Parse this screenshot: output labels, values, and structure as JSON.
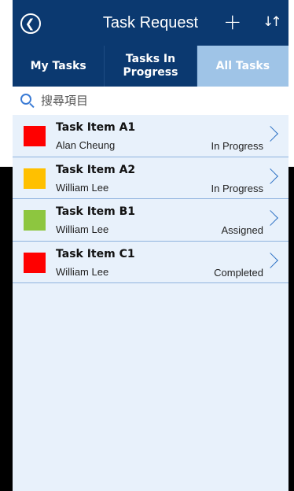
{
  "header": {
    "title": "Task Request",
    "back_icon": "back-circle-icon",
    "add_icon": "plus-icon",
    "sort_icon": "sort-arrows-icon"
  },
  "tabs": [
    {
      "label": "My Tasks",
      "active": false
    },
    {
      "label": "Tasks In Progress",
      "active": false
    },
    {
      "label": "All Tasks",
      "active": true
    }
  ],
  "search": {
    "placeholder": "搜尋項目",
    "value": ""
  },
  "tasks": [
    {
      "title": "Task Item A1",
      "assignee": "Alan Cheung",
      "status": "In Progress",
      "color": "#ff0000"
    },
    {
      "title": "Task Item A2",
      "assignee": "William Lee",
      "status": "In Progress",
      "color": "#ffc000"
    },
    {
      "title": "Task Item B1",
      "assignee": "William Lee",
      "status": "Assigned",
      "color": "#8dc63f"
    },
    {
      "title": "Task Item C1",
      "assignee": "William Lee",
      "status": "Completed",
      "color": "#ff0000"
    }
  ],
  "colors": {
    "header_bg": "#0b3970",
    "active_tab": "#9fc4e7",
    "list_bg": "#e8f1fb",
    "accent": "#2a6fc4"
  }
}
